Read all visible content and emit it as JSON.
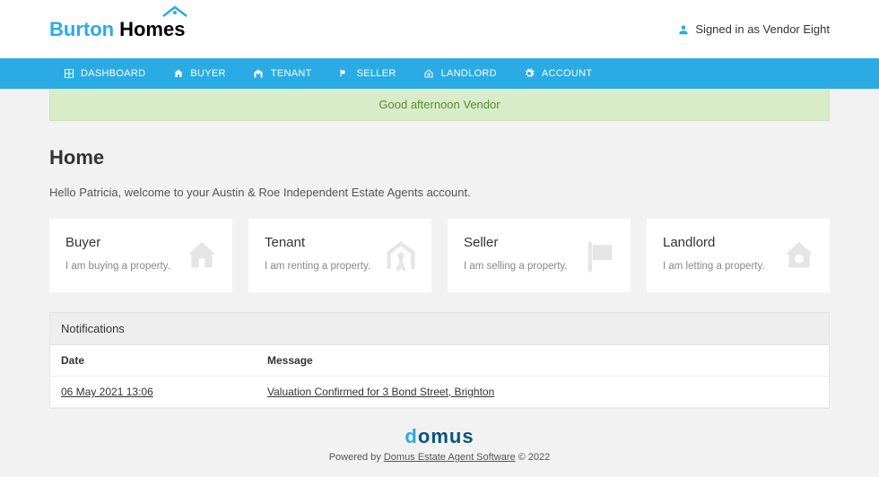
{
  "header": {
    "logo_left": "Burton",
    "logo_right": "Homes",
    "user_status": "Signed in as Vendor Eight"
  },
  "nav": [
    {
      "label": "DASHBOARD",
      "icon": "grid"
    },
    {
      "label": "BUYER",
      "icon": "home"
    },
    {
      "label": "TENANT",
      "icon": "person-shelter"
    },
    {
      "label": "SELLER",
      "icon": "tag"
    },
    {
      "label": "LANDLORD",
      "icon": "landlord-home"
    },
    {
      "label": "ACCOUNT",
      "icon": "gear"
    }
  ],
  "banner": "Good afternoon Vendor",
  "page_title": "Home",
  "welcome": "Hello Patricia, welcome to your Austin & Roe Independent Estate Agents account.",
  "cards": [
    {
      "title": "Buyer",
      "desc": "I am buying a property."
    },
    {
      "title": "Tenant",
      "desc": "I am renting a property."
    },
    {
      "title": "Seller",
      "desc": "I am selling a property."
    },
    {
      "title": "Landlord",
      "desc": "I am letting a property."
    }
  ],
  "notifications": {
    "header": "Notifications",
    "columns": {
      "date": "Date",
      "message": "Message"
    },
    "rows": [
      {
        "date": "06 May 2021 13:06",
        "message": "Valuation Confirmed for 3 Bond Street, Brighton"
      }
    ]
  },
  "footer": {
    "logo_d": "d",
    "logo_rest": "omus",
    "prefix": "Powered by ",
    "link": "Domus Estate Agent Software",
    "suffix": " © 2022"
  }
}
